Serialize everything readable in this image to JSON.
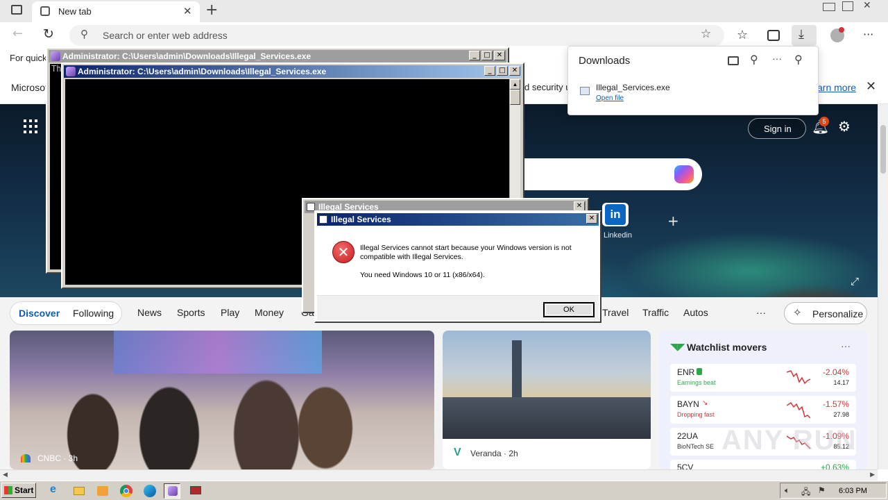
{
  "browser": {
    "tab_title": "New tab",
    "address_placeholder": "Search or enter web address",
    "favorites_bar_text": "For quick",
    "infobar_text_left": "Microsof",
    "infobar_text_mid": "d security u",
    "infobar_link": "arn more"
  },
  "downloads": {
    "title": "Downloads",
    "file_name": "Illegal_Services.exe",
    "open_link": "Open file"
  },
  "page": {
    "sign_in": "Sign in",
    "notification_count": "5",
    "linkedin_label": "Linkedin",
    "nav": {
      "discover": "Discover",
      "following": "Following",
      "news": "News",
      "sports": "Sports",
      "play": "Play",
      "money": "Money",
      "gaming_partial": "Ga",
      "travel": "Travel",
      "traffic": "Traffic",
      "autos": "Autos",
      "more": "···",
      "personalize": "Personalize"
    },
    "card1_source": "CNBC · 3h",
    "card2_source": "Veranda · 2h",
    "watchlist": {
      "title": "Watchlist movers",
      "items": [
        {
          "symbol": "ENR",
          "sub": "Earnings beat",
          "change": "-2.04%",
          "price": "14.17"
        },
        {
          "symbol": "BAYN",
          "sub": "Dropping fast",
          "change": "-1.57%",
          "price": "27.98"
        },
        {
          "symbol": "22UA",
          "sub": "BioNTech SE",
          "change": "-1.09%",
          "price": "85.12"
        },
        {
          "symbol": "5CV",
          "sub": "",
          "change": "+0.63%",
          "price": ""
        }
      ]
    }
  },
  "console": {
    "title": "Administrator: C:\\Users\\admin\\Downloads\\Illegal_Services.exe",
    "partial_text": "Th"
  },
  "dialog": {
    "title": "Illegal Services",
    "message_line1": "Illegal Services cannot start because your Windows version is not",
    "message_line2": "compatible with Illegal Services.",
    "message_line3": "You need Windows 10 or 11 (x86/x64).",
    "ok": "OK"
  },
  "taskbar": {
    "start": "Start",
    "clock": "6:03 PM"
  },
  "colors": {
    "accent": "#0a5fb4",
    "negative": "#d13438",
    "xp_title": "#0a246a"
  }
}
